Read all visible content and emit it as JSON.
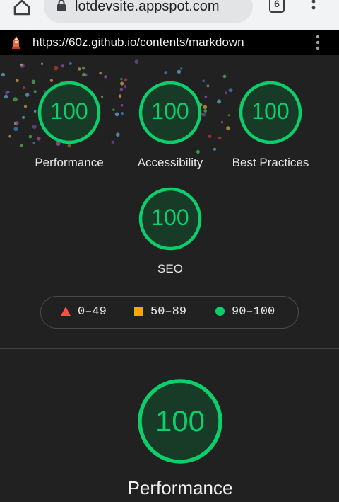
{
  "browser": {
    "omnibox_text": "lotdevsite.appspot.com",
    "tab_count": "6",
    "custom_tab_url": "https://60z.github.io/contents/markdown"
  },
  "scores": [
    {
      "label": "Performance",
      "score": "100"
    },
    {
      "label": "Accessibility",
      "score": "100"
    },
    {
      "label": "Best Practices",
      "score": "100"
    },
    {
      "label": "SEO",
      "score": "100"
    }
  ],
  "legend": [
    {
      "range": "0–49",
      "shape": "triangle",
      "color": "#ff4e42"
    },
    {
      "range": "50–89",
      "shape": "square",
      "color": "#ffa400"
    },
    {
      "range": "90–100",
      "shape": "circle",
      "color": "#0cce6b"
    }
  ],
  "section": {
    "score": "100",
    "title": "Performance"
  },
  "colors": {
    "pass": "#0cce6b",
    "pass_bg": "#173b27",
    "background": "#212121"
  }
}
